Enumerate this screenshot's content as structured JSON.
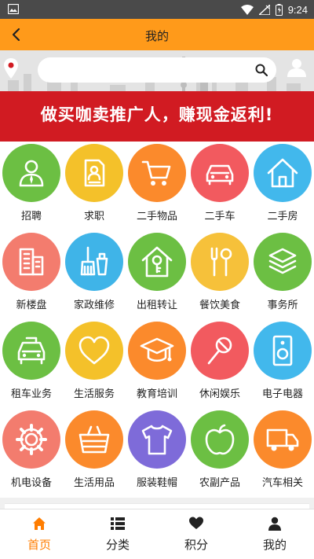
{
  "status_bar": {
    "time": "9:24"
  },
  "header": {
    "title": "我的"
  },
  "banner": {
    "slogan": "做买咖卖推广人，赚现金返利!",
    "search_placeholder": ""
  },
  "categories": [
    {
      "label": "招聘",
      "icon": "recruit-icon",
      "color": "#6cbf43"
    },
    {
      "label": "求职",
      "icon": "resume-icon",
      "color": "#f4c12a"
    },
    {
      "label": "二手物品",
      "icon": "cart-icon",
      "color": "#fb8a2c"
    },
    {
      "label": "二手车",
      "icon": "car-icon",
      "color": "#f25a5f"
    },
    {
      "label": "二手房",
      "icon": "house-icon",
      "color": "#42b8ec"
    },
    {
      "label": "新楼盘",
      "icon": "building-icon",
      "color": "#f37c6e"
    },
    {
      "label": "家政维修",
      "icon": "cleaning-icon",
      "color": "#3fb4e8"
    },
    {
      "label": "出租转让",
      "icon": "rent-key-icon",
      "color": "#6cbf43"
    },
    {
      "label": "餐饮美食",
      "icon": "cutlery-icon",
      "color": "#f6c13a"
    },
    {
      "label": "事务所",
      "icon": "layers-icon",
      "color": "#6cbf43"
    },
    {
      "label": "租车业务",
      "icon": "taxi-icon",
      "color": "#6cbf43"
    },
    {
      "label": "生活服务",
      "icon": "heart-icon",
      "color": "#f4c12a"
    },
    {
      "label": "教育培训",
      "icon": "graduation-cap-icon",
      "color": "#fb8a2c"
    },
    {
      "label": "休闲娱乐",
      "icon": "microphone-icon",
      "color": "#f25a5f"
    },
    {
      "label": "电子电器",
      "icon": "speaker-icon",
      "color": "#42b8ec"
    },
    {
      "label": "机电设备",
      "icon": "gear-icon",
      "color": "#f37c6e"
    },
    {
      "label": "生活用品",
      "icon": "basket-icon",
      "color": "#fb8a2c"
    },
    {
      "label": "服装鞋帽",
      "icon": "tshirt-icon",
      "color": "#7e6bd9"
    },
    {
      "label": "农副产品",
      "icon": "apple-icon",
      "color": "#6cbf43"
    },
    {
      "label": "汽车相关",
      "icon": "truck-icon",
      "color": "#fb8a2c"
    }
  ],
  "bottom_nav": [
    {
      "label": "首页",
      "icon": "home-icon",
      "active": true
    },
    {
      "label": "分类",
      "icon": "list-icon",
      "active": false
    },
    {
      "label": "积分",
      "icon": "heart-icon",
      "active": false
    },
    {
      "label": "我的",
      "icon": "user-icon",
      "active": false
    }
  ],
  "colors": {
    "accent": "#ff9a1a",
    "active_nav": "#ff7d00",
    "banner_red": "#d11b22"
  }
}
